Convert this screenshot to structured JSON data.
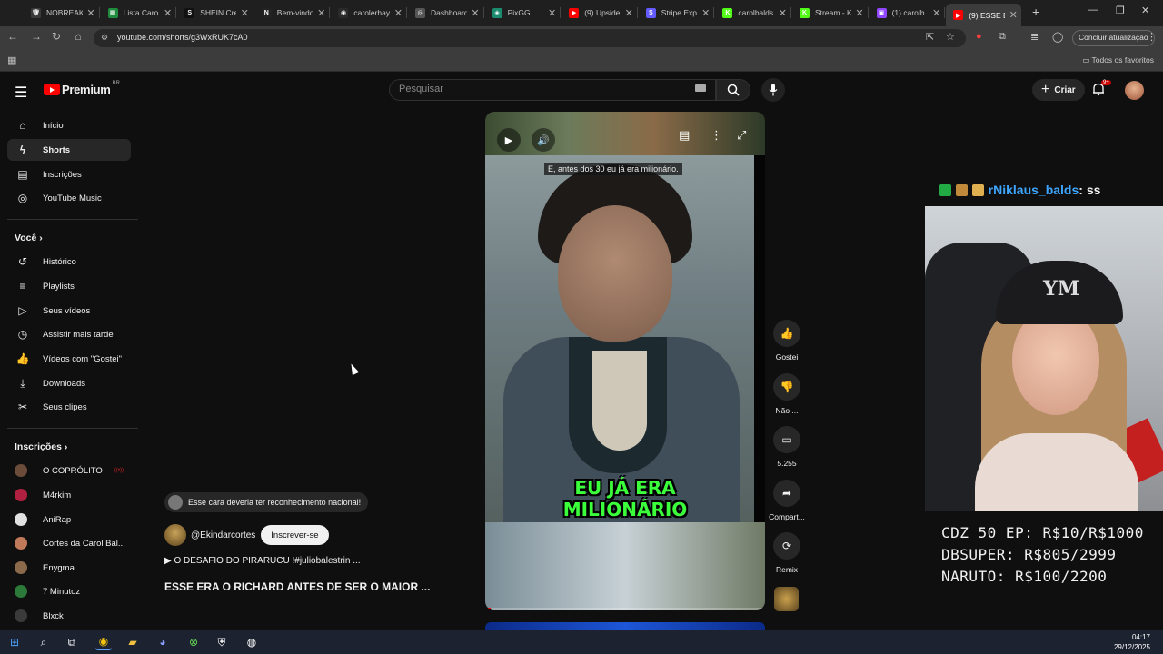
{
  "browser": {
    "tabs": [
      {
        "label": "NOBREAK",
        "fav_color": "#3a3a3a",
        "fav_text": "🛡"
      },
      {
        "label": "Lista Caro",
        "fav_color": "#1e8e3e",
        "fav_text": "▦"
      },
      {
        "label": "SHEIN Cre",
        "fav_color": "#111111",
        "fav_text": "S"
      },
      {
        "label": "Bem-vindo",
        "fav_color": "#222222",
        "fav_text": "N"
      },
      {
        "label": "carolerhay",
        "fav_color": "#2a2a2a",
        "fav_text": "◉"
      },
      {
        "label": "Dashboard",
        "fav_color": "#555555",
        "fav_text": "◎"
      },
      {
        "label": "PixGG",
        "fav_color": "#1b8b6f",
        "fav_text": "◈"
      },
      {
        "label": "(9) Upside",
        "fav_color": "#ff0000",
        "fav_text": "▶"
      },
      {
        "label": "Stripe Exp",
        "fav_color": "#635bff",
        "fav_text": "S"
      },
      {
        "label": "carolbalds",
        "fav_color": "#53fc18",
        "fav_text": "K"
      },
      {
        "label": "Stream - K",
        "fav_color": "#53fc18",
        "fav_text": "K"
      },
      {
        "label": "(1) carolb",
        "fav_color": "#9146ff",
        "fav_text": "▣"
      },
      {
        "label": "(9) ESSE E",
        "fav_color": "#ff0000",
        "fav_text": "▶"
      }
    ],
    "new_tab": "+",
    "url": "youtube.com/shorts/g3WxRUK7cA0",
    "update_label": "Concluir atualização",
    "all_favorites": "Todos os favoritos"
  },
  "youtube": {
    "logo_word": "Premium",
    "country": "BR",
    "search_placeholder": "Pesquisar",
    "create_label": "Criar",
    "notif_count": "9+",
    "sidebar": {
      "main": [
        {
          "label": "Início",
          "icon": "home-icon",
          "glyph": "⌂"
        },
        {
          "label": "Shorts",
          "icon": "shorts-icon",
          "glyph": "ϟ"
        },
        {
          "label": "Inscrições",
          "icon": "subscriptions-icon",
          "glyph": "▤"
        },
        {
          "label": "YouTube Music",
          "icon": "music-icon",
          "glyph": "◎"
        }
      ],
      "you_header": "Você",
      "you": [
        {
          "label": "Histórico",
          "icon": "history-icon",
          "glyph": "↺"
        },
        {
          "label": "Playlists",
          "icon": "playlists-icon",
          "glyph": "≡"
        },
        {
          "label": "Seus vídeos",
          "icon": "your-videos-icon",
          "glyph": "▷"
        },
        {
          "label": "Assistir mais tarde",
          "icon": "watch-later-icon",
          "glyph": "◷"
        },
        {
          "label": "Vídeos com \"Gostei\"",
          "icon": "liked-icon",
          "glyph": "👍"
        },
        {
          "label": "Downloads",
          "icon": "download-icon",
          "glyph": "⤓"
        },
        {
          "label": "Seus clipes",
          "icon": "clips-icon",
          "glyph": "✂"
        }
      ],
      "subs_header": "Inscrições",
      "subs": [
        {
          "label": "O COPRÓLITO",
          "color": "#6b4c3b",
          "live": true
        },
        {
          "label": "M4rkim",
          "color": "#b02040",
          "live": false
        },
        {
          "label": "AniRap",
          "color": "#e0e0e0",
          "live": false
        },
        {
          "label": "Cortes da Carol Bal...",
          "color": "#c07a5a",
          "live": false
        },
        {
          "label": "Enygma",
          "color": "#8a6a4a",
          "live": false
        },
        {
          "label": "7 Minutoz",
          "color": "#2b7a3a",
          "live": false
        },
        {
          "label": "Blxck",
          "color": "#3a3a3a",
          "live": false
        }
      ]
    },
    "short": {
      "comment": "Esse cara deveria ter reconhecimento nacional!",
      "channel": "@Ekindarcortes",
      "subscribe": "Inscrever-se",
      "playlist": "▶ O DESAFIO DO PIRARUCU !#juliobalestrin ...",
      "title": "ESSE ERA O RICHARD ANTES DE SER O MAIOR ...",
      "caption_top": "E, antes dos 30 eu já era milionário.",
      "caption_big_1": "EU JÁ ERA",
      "caption_big_2": "MILIONÁRIO",
      "progress": 0.02
    },
    "actions": [
      {
        "label": "Gostei",
        "icon": "like-icon",
        "glyph": "👍"
      },
      {
        "label": "Não ...",
        "icon": "dislike-icon",
        "glyph": "👎"
      },
      {
        "label": "5.255",
        "icon": "comments-icon",
        "glyph": "▭"
      },
      {
        "label": "Compart...",
        "icon": "share-icon",
        "glyph": "➦"
      },
      {
        "label": "Remix",
        "icon": "remix-icon",
        "glyph": "⟳"
      }
    ]
  },
  "stream": {
    "chat_user": "rNiklaus_balds",
    "chat_msg": ": ss",
    "cap_text": "YM",
    "promo": [
      "CDZ 50 EP: R$10/R$1000",
      "DBSUPER: R$805/2999",
      "NARUTO: R$100/2200"
    ]
  },
  "taskbar": {
    "time": "04:17",
    "date": "29/12/2025"
  }
}
